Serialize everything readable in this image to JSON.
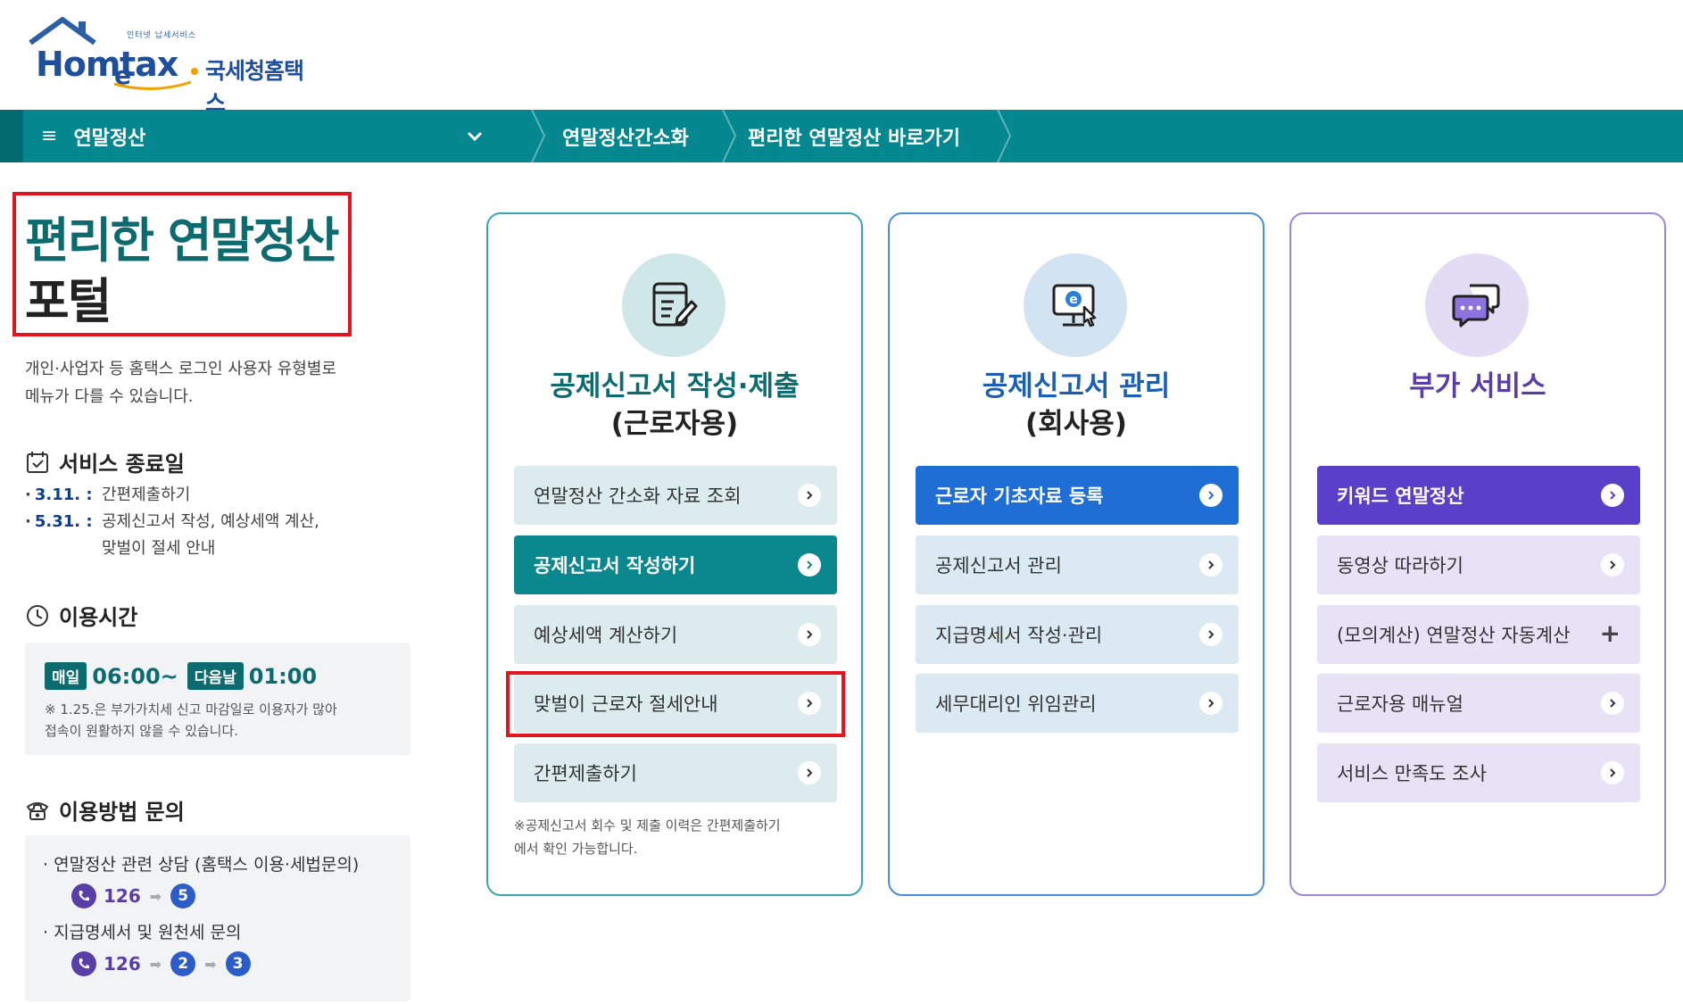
{
  "logo": {
    "tagline": "인터넷 납세서비스",
    "brand_hom": "Hom",
    "brand_e": "e",
    "brand_tax": "tax",
    "brand_kr": "국세청홈택스"
  },
  "nav": {
    "menu_label": "연말정산",
    "breadcrumbs": [
      "연말정산간소화",
      "편리한 연말정산 바로가기"
    ]
  },
  "hero": {
    "title_line1": "편리한 연말정산",
    "title_line2": "포털",
    "intro_line1": "개인·사업자 등 홈택스 로그인 사용자 유형별로",
    "intro_line2": "메뉴가 다를 수 있습니다."
  },
  "end_date": {
    "heading": "서비스 종료일",
    "rows": [
      {
        "date": "3.11. :",
        "text": "간편제출하기"
      },
      {
        "date": "5.31. :",
        "text": "공제신고서 작성, 예상세액 계산,",
        "text2": "맞벌이 절세 안내"
      }
    ]
  },
  "hours": {
    "heading": "이용시간",
    "pill1": "매일",
    "time1": "06:00~",
    "pill2": "다음날",
    "time2": "01:00",
    "note_line1": "※ 1.25.은 부가가치세 신고 마감일로 이용자가 많아",
    "note_line2": "접속이 원활하지 않을 수 있습니다."
  },
  "inquiry": {
    "heading": "이용방법 문의",
    "items": [
      {
        "label": "연말정산 관련 상담 (홈택스 이용·세법문의)",
        "phone": "126",
        "keys": [
          "5"
        ]
      },
      {
        "label": "지급명세서 및 원천세 문의",
        "phone": "126",
        "keys": [
          "2",
          "3"
        ]
      }
    ]
  },
  "cards": [
    {
      "title_a": "공제신고서 작성·제출",
      "title_b": "(근로자용)",
      "buttons": [
        "연말정산 간소화 자료 조회",
        "공제신고서 작성하기",
        "예상세액 계산하기",
        "맞벌이 근로자 절세안내",
        "간편제출하기"
      ],
      "note_line1": "※공제신고서 회수 및 제출 이력은 간편제출하기",
      "note_line2": "에서 확인 가능합니다."
    },
    {
      "title_a": "공제신고서 관리",
      "title_b": "(회사용)",
      "buttons": [
        "근로자 기초자료 등록",
        "공제신고서 관리",
        "지급명세서 작성·관리",
        "세무대리인 위임관리"
      ]
    },
    {
      "title_a": "부가 서비스",
      "buttons": [
        "키워드 연말정산",
        "동영상 따라하기",
        "(모의계산) 연말정산 자동계산",
        "근로자용 매뉴얼",
        "서비스 만족도 조사"
      ]
    }
  ],
  "colors": {
    "teal": "#04878e",
    "blue": "#1e6ed6",
    "purple": "#5a3fc8",
    "highlight": "#e3141e"
  },
  "icons": {
    "card1": "document-edit-icon",
    "card2": "monitor-e-cursor-icon",
    "card3": "chat-bubbles-icon"
  }
}
